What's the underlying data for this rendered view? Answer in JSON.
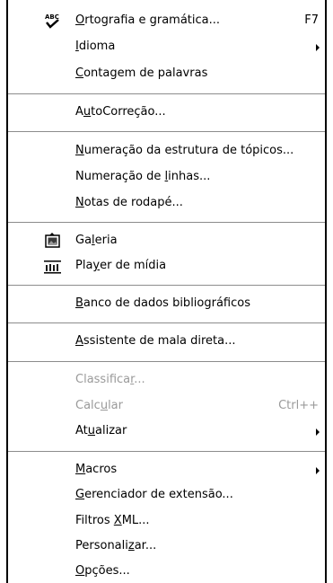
{
  "menu": {
    "items": [
      {
        "pre": "",
        "acc": "O",
        "post": "rtografia e gramática...",
        "shortcut": "F7",
        "submenu": false,
        "disabled": false,
        "icon": "spellcheck-icon"
      },
      {
        "pre": "",
        "acc": "I",
        "post": "dioma",
        "shortcut": "",
        "submenu": true,
        "disabled": false,
        "icon": ""
      },
      {
        "pre": "",
        "acc": "C",
        "post": "ontagem de palavras",
        "shortcut": "",
        "submenu": false,
        "disabled": false,
        "icon": ""
      },
      {
        "pre": "A",
        "acc": "u",
        "post": "toCorreção...",
        "shortcut": "",
        "submenu": false,
        "disabled": false,
        "icon": ""
      },
      {
        "pre": "",
        "acc": "N",
        "post": "umeração da estrutura de tópicos...",
        "shortcut": "",
        "submenu": false,
        "disabled": false,
        "icon": ""
      },
      {
        "pre": "Numeração de ",
        "acc": "l",
        "post": "inhas...",
        "shortcut": "",
        "submenu": false,
        "disabled": false,
        "icon": ""
      },
      {
        "pre": "",
        "acc": "N",
        "post": "otas de rodapé...",
        "shortcut": "",
        "submenu": false,
        "disabled": false,
        "icon": ""
      },
      {
        "pre": "Ga",
        "acc": "l",
        "post": "eria",
        "shortcut": "",
        "submenu": false,
        "disabled": false,
        "icon": "gallery-icon"
      },
      {
        "pre": "Pla",
        "acc": "y",
        "post": "er de mídia",
        "shortcut": "",
        "submenu": false,
        "disabled": false,
        "icon": "media-player-icon"
      },
      {
        "pre": "",
        "acc": "B",
        "post": "anco de dados bibliográficos",
        "shortcut": "",
        "submenu": false,
        "disabled": false,
        "icon": ""
      },
      {
        "pre": "",
        "acc": "A",
        "post": "ssistente de mala direta...",
        "shortcut": "",
        "submenu": false,
        "disabled": false,
        "icon": ""
      },
      {
        "pre": "Classifica",
        "acc": "r",
        "post": "...",
        "shortcut": "",
        "submenu": false,
        "disabled": true,
        "icon": ""
      },
      {
        "pre": "Calc",
        "acc": "u",
        "post": "lar",
        "shortcut": "Ctrl++",
        "submenu": false,
        "disabled": true,
        "icon": ""
      },
      {
        "pre": "At",
        "acc": "u",
        "post": "alizar",
        "shortcut": "",
        "submenu": true,
        "disabled": false,
        "icon": ""
      },
      {
        "pre": "",
        "acc": "M",
        "post": "acros",
        "shortcut": "",
        "submenu": true,
        "disabled": false,
        "icon": ""
      },
      {
        "pre": "",
        "acc": "G",
        "post": "erenciador de extensão...",
        "shortcut": "",
        "submenu": false,
        "disabled": false,
        "icon": ""
      },
      {
        "pre": "Filtros ",
        "acc": "X",
        "post": "ML...",
        "shortcut": "",
        "submenu": false,
        "disabled": false,
        "icon": ""
      },
      {
        "pre": "Personali",
        "acc": "z",
        "post": "ar...",
        "shortcut": "",
        "submenu": false,
        "disabled": false,
        "icon": ""
      },
      {
        "pre": "",
        "acc": "O",
        "post": "pções...",
        "shortcut": "",
        "submenu": false,
        "disabled": false,
        "icon": ""
      }
    ]
  }
}
